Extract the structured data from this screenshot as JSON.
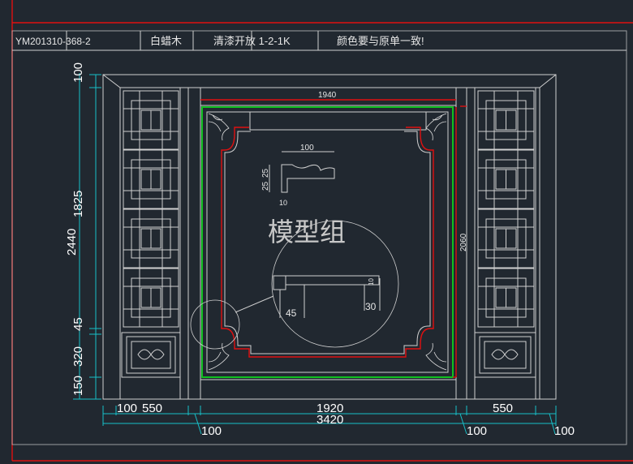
{
  "title_block": {
    "code": "YM201310-368-2",
    "code_overlap": "8-2",
    "material": "白蜡木",
    "finish": "清漆开放 1-2-1K",
    "note": "颜色要与原单一致!"
  },
  "watermark": "模型组",
  "dimensions": {
    "top_width": "1940",
    "right_height": "2060",
    "left": [
      "100",
      "1825",
      "2440",
      "45",
      "320",
      "150"
    ],
    "bottom_row1": [
      "100",
      "550",
      "1920",
      "550"
    ],
    "bottom_total": "3420",
    "bottom_leaders": [
      "100",
      "100",
      "100"
    ],
    "profile_width": "100",
    "profile_heights": [
      "25",
      "25"
    ],
    "profile_thickness": "10",
    "detail_left": "45",
    "detail_right": "30",
    "detail_small": "10"
  },
  "colors": {
    "background": "#212830",
    "dimension_lines": "#18c0c8",
    "highlight_red": "#e01010",
    "highlight_green": "#10c020"
  }
}
